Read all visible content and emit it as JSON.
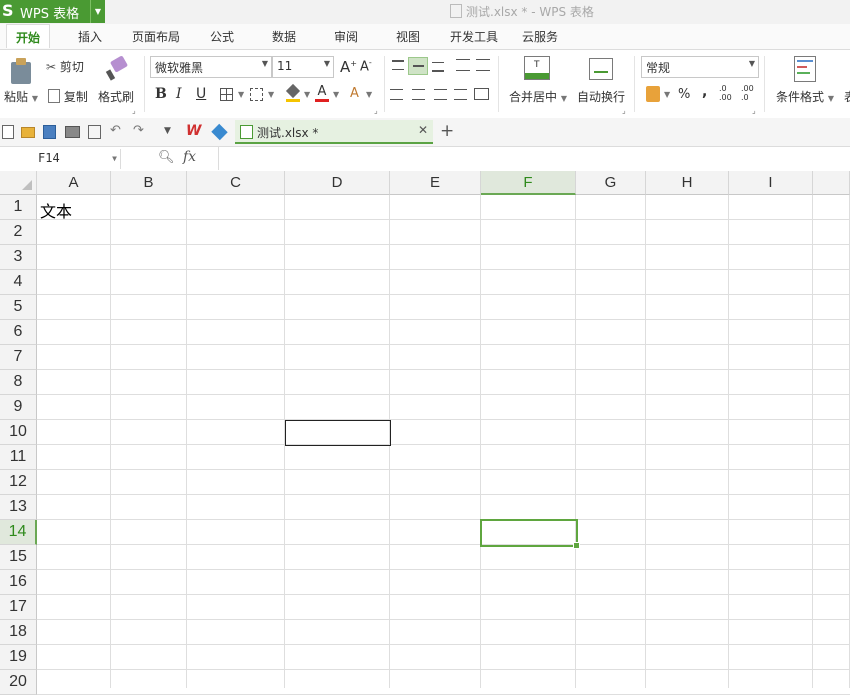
{
  "app": {
    "logo": "S",
    "name": "WPS 表格",
    "doc_title": "测试.xlsx * - WPS 表格"
  },
  "menu_tabs": [
    "开始",
    "插入",
    "页面布局",
    "公式",
    "数据",
    "审阅",
    "视图",
    "开发工具",
    "云服务"
  ],
  "ribbon": {
    "paste": "粘贴",
    "cut": "剪切",
    "copy": "复制",
    "format_painter": "格式刷",
    "font_name": "微软雅黑",
    "font_size": "11",
    "bold": "B",
    "italic": "I",
    "underline": "U",
    "merge_center": "合并居中",
    "wrap_text": "自动换行",
    "number_format": "常规",
    "percent": "%",
    "comma": ",",
    "conditional_format": "条件格式",
    "table_style_partial": "表"
  },
  "quick_toolbar": {
    "file_tab": "测试.xlsx *"
  },
  "formula_bar": {
    "name_box": "F14",
    "fx": "fx",
    "formula": ""
  },
  "sheet": {
    "columns": [
      "A",
      "B",
      "C",
      "D",
      "E",
      "F",
      "G",
      "H",
      "I"
    ],
    "rows": [
      "1",
      "2",
      "3",
      "4",
      "5",
      "6",
      "7",
      "8",
      "9",
      "10",
      "11",
      "12",
      "13",
      "14",
      "15",
      "16",
      "17",
      "18",
      "19",
      "20"
    ],
    "selected_column": "F",
    "selected_row": "14",
    "cell_A1": "文本"
  },
  "colors": {
    "brand": "#4a9a33",
    "selection": "#5fa63f"
  }
}
